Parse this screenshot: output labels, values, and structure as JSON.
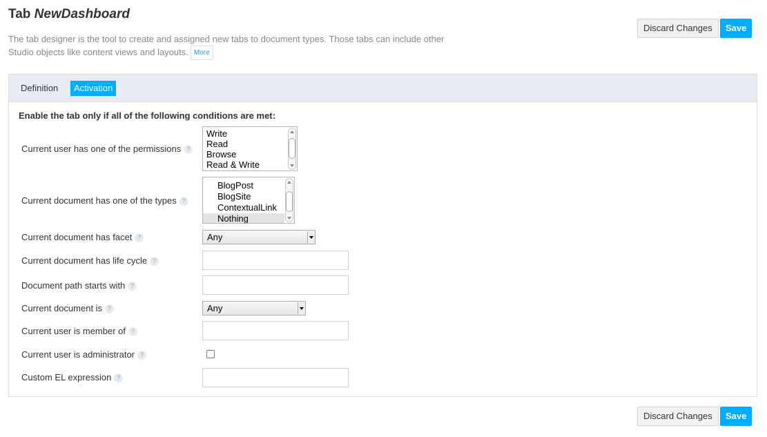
{
  "header": {
    "title_prefix": "Tab",
    "title_name": "NewDashboard",
    "description": "The tab designer is the tool to create and assigned new tabs to document types. Those tabs can include other Studio objects like content views and layouts.",
    "more_label": "More"
  },
  "actions": {
    "discard_label": "Discard Changes",
    "save_label": "Save"
  },
  "tabs": [
    {
      "label": "Definition",
      "active": false
    },
    {
      "label": "Activation",
      "active": true
    }
  ],
  "conditions": {
    "heading": "Enable the tab only if all of the following conditions are met:",
    "help_glyph": "?",
    "permissions": {
      "label": "Current user has one of the permissions",
      "options": [
        "Write",
        "Read",
        "Browse",
        "Read & Write"
      ]
    },
    "types": {
      "label": "Current document has one of the types",
      "options": [
        "BlogPost",
        "BlogSite",
        "ContextualLink",
        "Nothing"
      ],
      "selected": "Nothing"
    },
    "facet": {
      "label": "Current document has facet",
      "value": "Any"
    },
    "lifecycle": {
      "label": "Current document has life cycle",
      "value": ""
    },
    "path": {
      "label": "Document path starts with",
      "value": ""
    },
    "doc_is": {
      "label": "Current document is",
      "value": "Any"
    },
    "member_of": {
      "label": "Current user is member of",
      "value": ""
    },
    "administrator": {
      "label": "Current user is administrator",
      "checked": false
    },
    "el_expression": {
      "label": "Custom EL expression",
      "value": ""
    }
  },
  "colors": {
    "accent": "#00adff",
    "tabbar_bg": "#e8ecf2",
    "muted_text": "#888888"
  }
}
